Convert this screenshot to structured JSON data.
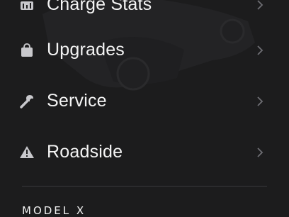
{
  "menu": {
    "items": [
      {
        "label": "Charge Stats",
        "icon": "bar-chart-icon"
      },
      {
        "label": "Upgrades",
        "icon": "shopping-bag-icon"
      },
      {
        "label": "Service",
        "icon": "wrench-icon"
      },
      {
        "label": "Roadside",
        "icon": "warning-triangle-icon"
      }
    ]
  },
  "vehicle": {
    "model_name": "Model X"
  },
  "colors": {
    "background": "#1c1c1d",
    "text": "#f4f4f4",
    "icon": "#c8c8cc",
    "chevron": "#6e6e73",
    "divider": "#3a3a3c"
  }
}
